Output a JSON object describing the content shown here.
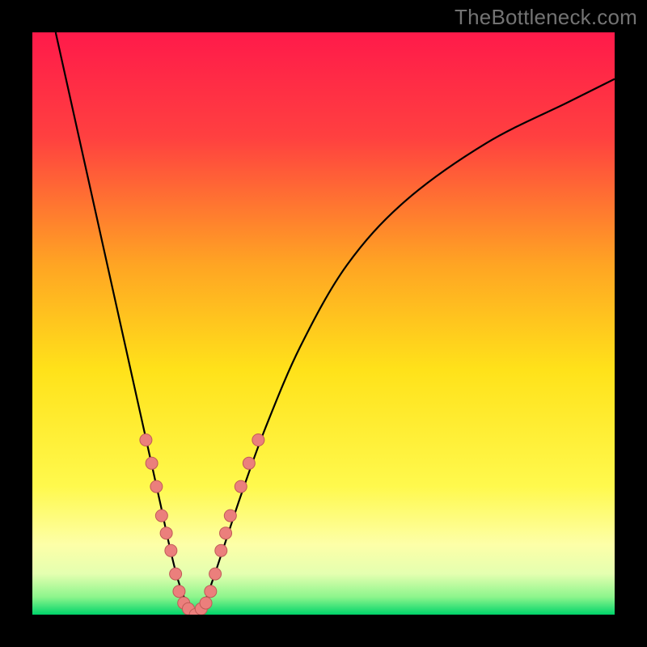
{
  "watermark": "TheBottleneck.com",
  "chart_data": {
    "type": "line",
    "title": "",
    "xlabel": "",
    "ylabel": "",
    "xlim": [
      0,
      100
    ],
    "ylim": [
      0,
      100
    ],
    "gradient": {
      "stops": [
        {
          "offset": 0.0,
          "color": "#ff1a4a"
        },
        {
          "offset": 0.18,
          "color": "#ff4040"
        },
        {
          "offset": 0.4,
          "color": "#ffa523"
        },
        {
          "offset": 0.58,
          "color": "#ffe21a"
        },
        {
          "offset": 0.78,
          "color": "#fff94d"
        },
        {
          "offset": 0.88,
          "color": "#fdffa8"
        },
        {
          "offset": 0.93,
          "color": "#e4ffb0"
        },
        {
          "offset": 0.97,
          "color": "#8cf58c"
        },
        {
          "offset": 1.0,
          "color": "#00d46a"
        }
      ]
    },
    "series": [
      {
        "name": "bottleneck-curve",
        "type": "line",
        "x": [
          4,
          6,
          8,
          10,
          12,
          14,
          16,
          18,
          20,
          22,
          23.5,
          25,
          26.5,
          28,
          29.5,
          31,
          33,
          36,
          40,
          46,
          54,
          64,
          78,
          92,
          100
        ],
        "y": [
          100,
          91,
          82,
          73,
          64,
          55,
          46,
          37,
          28,
          19,
          12,
          6,
          2,
          0,
          2,
          6,
          12,
          21,
          32,
          46,
          60,
          71,
          81,
          88,
          92
        ]
      },
      {
        "name": "scatter-points",
        "type": "scatter",
        "points": [
          {
            "x": 19.5,
            "y": 30
          },
          {
            "x": 20.5,
            "y": 26
          },
          {
            "x": 21.3,
            "y": 22
          },
          {
            "x": 22.2,
            "y": 17
          },
          {
            "x": 23.0,
            "y": 14
          },
          {
            "x": 23.8,
            "y": 11
          },
          {
            "x": 24.6,
            "y": 7
          },
          {
            "x": 25.2,
            "y": 4
          },
          {
            "x": 26.0,
            "y": 2
          },
          {
            "x": 26.8,
            "y": 1
          },
          {
            "x": 28.0,
            "y": 0
          },
          {
            "x": 29.0,
            "y": 1
          },
          {
            "x": 29.8,
            "y": 2
          },
          {
            "x": 30.6,
            "y": 4
          },
          {
            "x": 31.4,
            "y": 7
          },
          {
            "x": 32.4,
            "y": 11
          },
          {
            "x": 33.2,
            "y": 14
          },
          {
            "x": 34.0,
            "y": 17
          },
          {
            "x": 35.8,
            "y": 22
          },
          {
            "x": 37.2,
            "y": 26
          },
          {
            "x": 38.8,
            "y": 30
          }
        ]
      }
    ]
  }
}
